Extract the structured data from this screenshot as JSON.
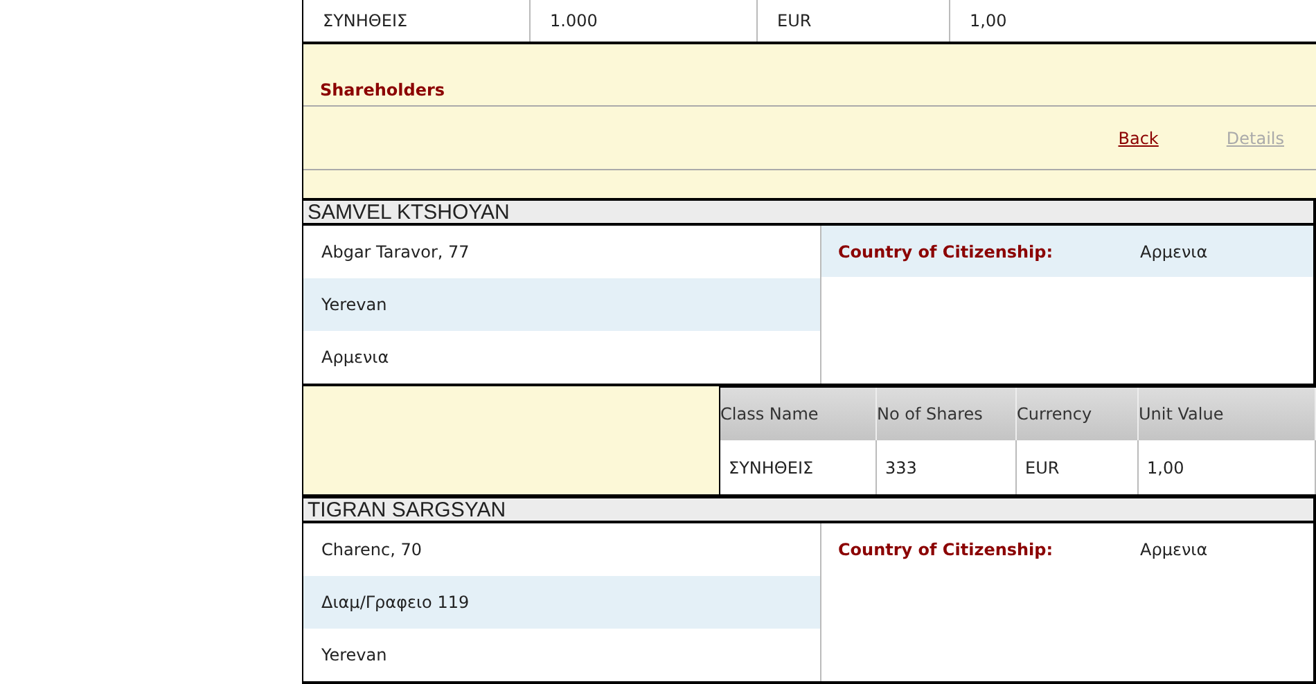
{
  "top_share_row": [
    "ΣΥΝΗΘΕΙΣ",
    "1.000",
    "EUR",
    "1,00"
  ],
  "section_title": "Shareholders",
  "nav_links": [
    {
      "label": "Back",
      "disabled": false
    },
    {
      "label": "Details",
      "disabled": true
    }
  ],
  "shareholders": [
    {
      "name": "SAMVEL KTSHOYAN",
      "address_lines": [
        {
          "text": "Abgar Taravor, 77",
          "highlighted": false
        },
        {
          "text": "Yerevan",
          "highlighted": true
        },
        {
          "text": "Αρμενια",
          "highlighted": false
        }
      ],
      "citizenship": {
        "label": "Country of Citizenship:",
        "value": "Αρμενια",
        "highlighted": true
      },
      "shares_table": {
        "columns": [
          "Class Name",
          "No of Shares",
          "Currency",
          "Unit Value"
        ],
        "rows": [
          [
            "ΣΥΝΗΘΕΙΣ",
            "333",
            "EUR",
            "1,00"
          ]
        ]
      }
    },
    {
      "name": "TIGRAN SARGSYAN",
      "address_lines": [
        {
          "text": "Charenc, 70",
          "highlighted": false
        },
        {
          "text": "Διαμ/Γραφειο 119",
          "highlighted": true
        },
        {
          "text": "Yerevan",
          "highlighted": false
        }
      ],
      "citizenship": {
        "label": "Country of Citizenship:",
        "value": "Αρμενια",
        "highlighted": false
      }
    }
  ]
}
